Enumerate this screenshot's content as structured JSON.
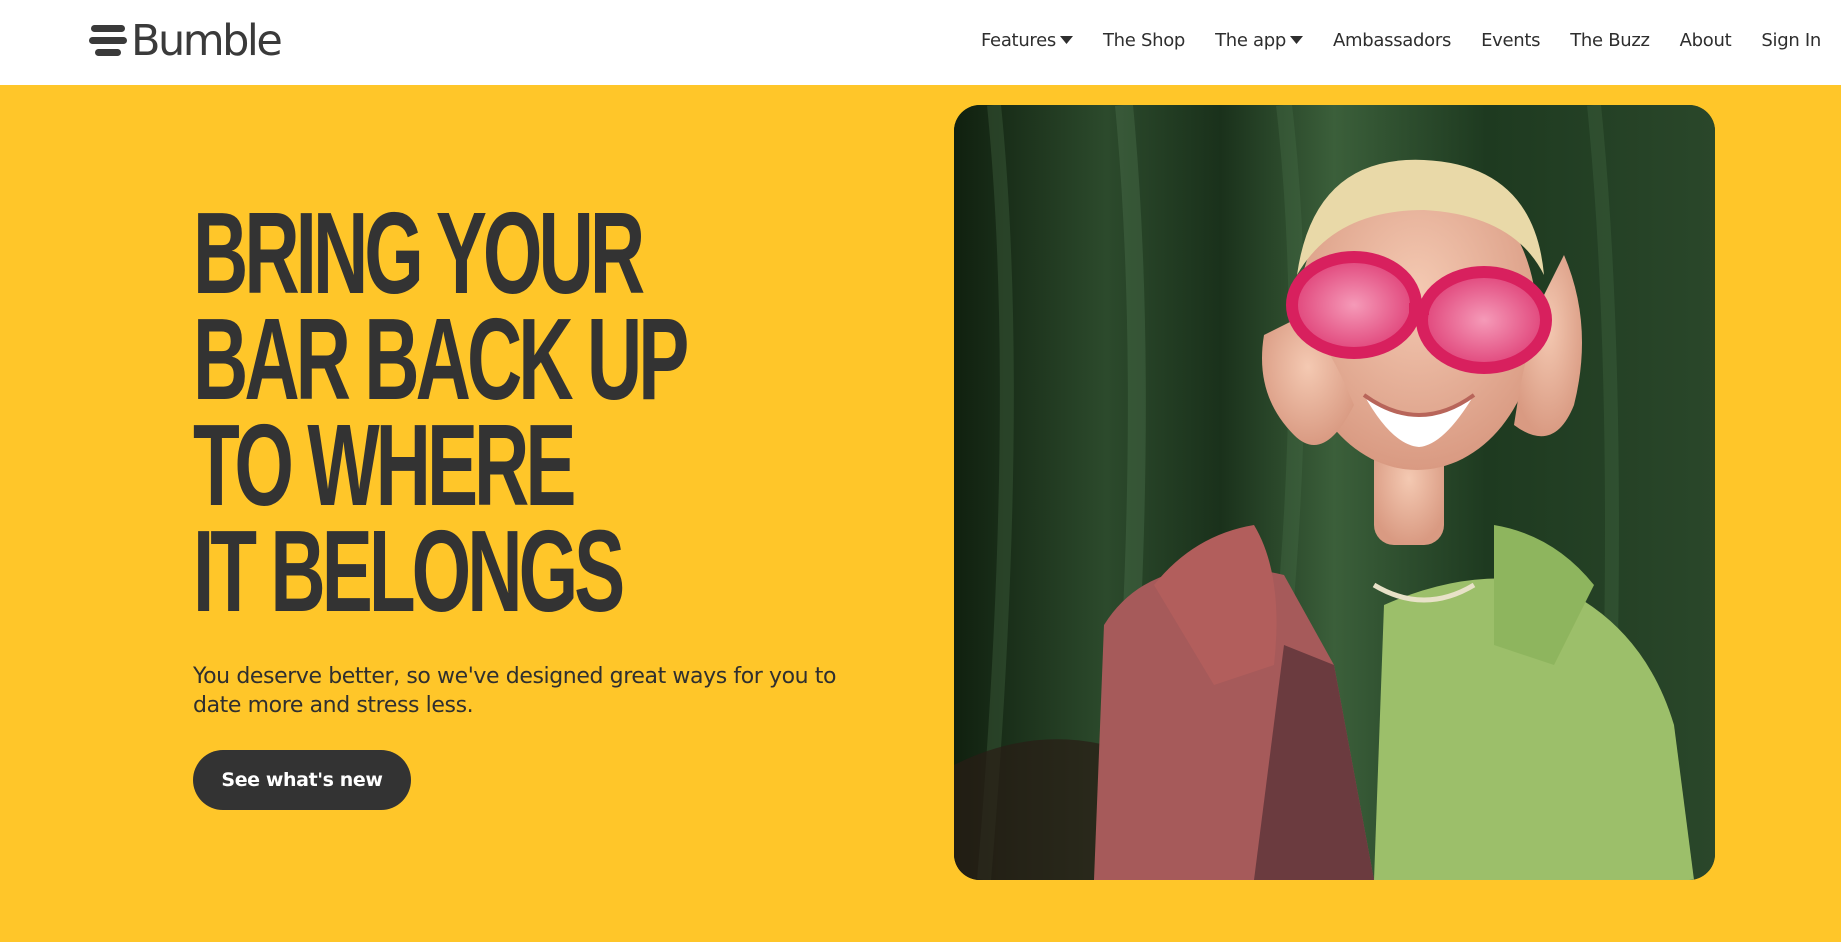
{
  "header": {
    "logo_text": "Bumble",
    "logo_icon": "bumble-lines-icon",
    "nav": [
      {
        "label": "Features",
        "has_dropdown": true
      },
      {
        "label": "The Shop",
        "has_dropdown": false
      },
      {
        "label": "The app",
        "has_dropdown": true
      },
      {
        "label": "Ambassadors",
        "has_dropdown": false
      },
      {
        "label": "Events",
        "has_dropdown": false
      },
      {
        "label": "The Buzz",
        "has_dropdown": false
      },
      {
        "label": "About",
        "has_dropdown": false
      },
      {
        "label": "Sign In",
        "has_dropdown": false
      }
    ]
  },
  "hero": {
    "headline_lines": [
      "BRING YOUR",
      "BAR BACK UP",
      "TO WHERE",
      "IT BELONGS"
    ],
    "subtitle": "You deserve better, so we've designed great ways for you to date more and stress less.",
    "cta_label": "See what's new",
    "image_subject": "smiling woman in pink sunglasses"
  },
  "colors": {
    "brand_yellow": "#FFC629",
    "text_dark": "#333333",
    "header_bg": "#FFFFFF",
    "button_text": "#FFFFFF"
  }
}
